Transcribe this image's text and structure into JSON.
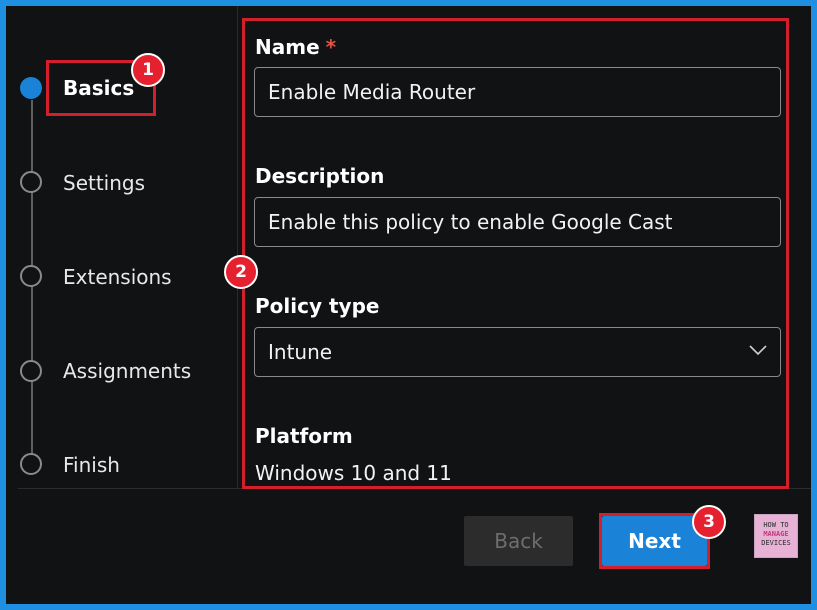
{
  "wizard": {
    "steps": [
      {
        "label": "Basics",
        "active": true
      },
      {
        "label": "Settings",
        "active": false
      },
      {
        "label": "Extensions",
        "active": false
      },
      {
        "label": "Assignments",
        "active": false
      },
      {
        "label": "Finish",
        "active": false
      }
    ]
  },
  "form": {
    "name": {
      "label": "Name",
      "required_mark": "*",
      "value": "Enable Media Router"
    },
    "description": {
      "label": "Description",
      "value": "Enable this policy to enable Google Cast"
    },
    "policy_type": {
      "label": "Policy type",
      "value": "Intune"
    },
    "platform": {
      "label": "Platform",
      "value": "Windows 10 and 11"
    }
  },
  "footer": {
    "back_label": "Back",
    "next_label": "Next"
  },
  "annotations": {
    "badges": [
      "1",
      "2",
      "3"
    ],
    "highlight_color": "#d21f2b"
  },
  "logo": {
    "line1": "HOW TO",
    "line2": "MANAGE",
    "line3": "DEVICES"
  },
  "colors": {
    "accent": "#1a83d8",
    "background": "#111214",
    "frame": "#1e8fe1"
  }
}
